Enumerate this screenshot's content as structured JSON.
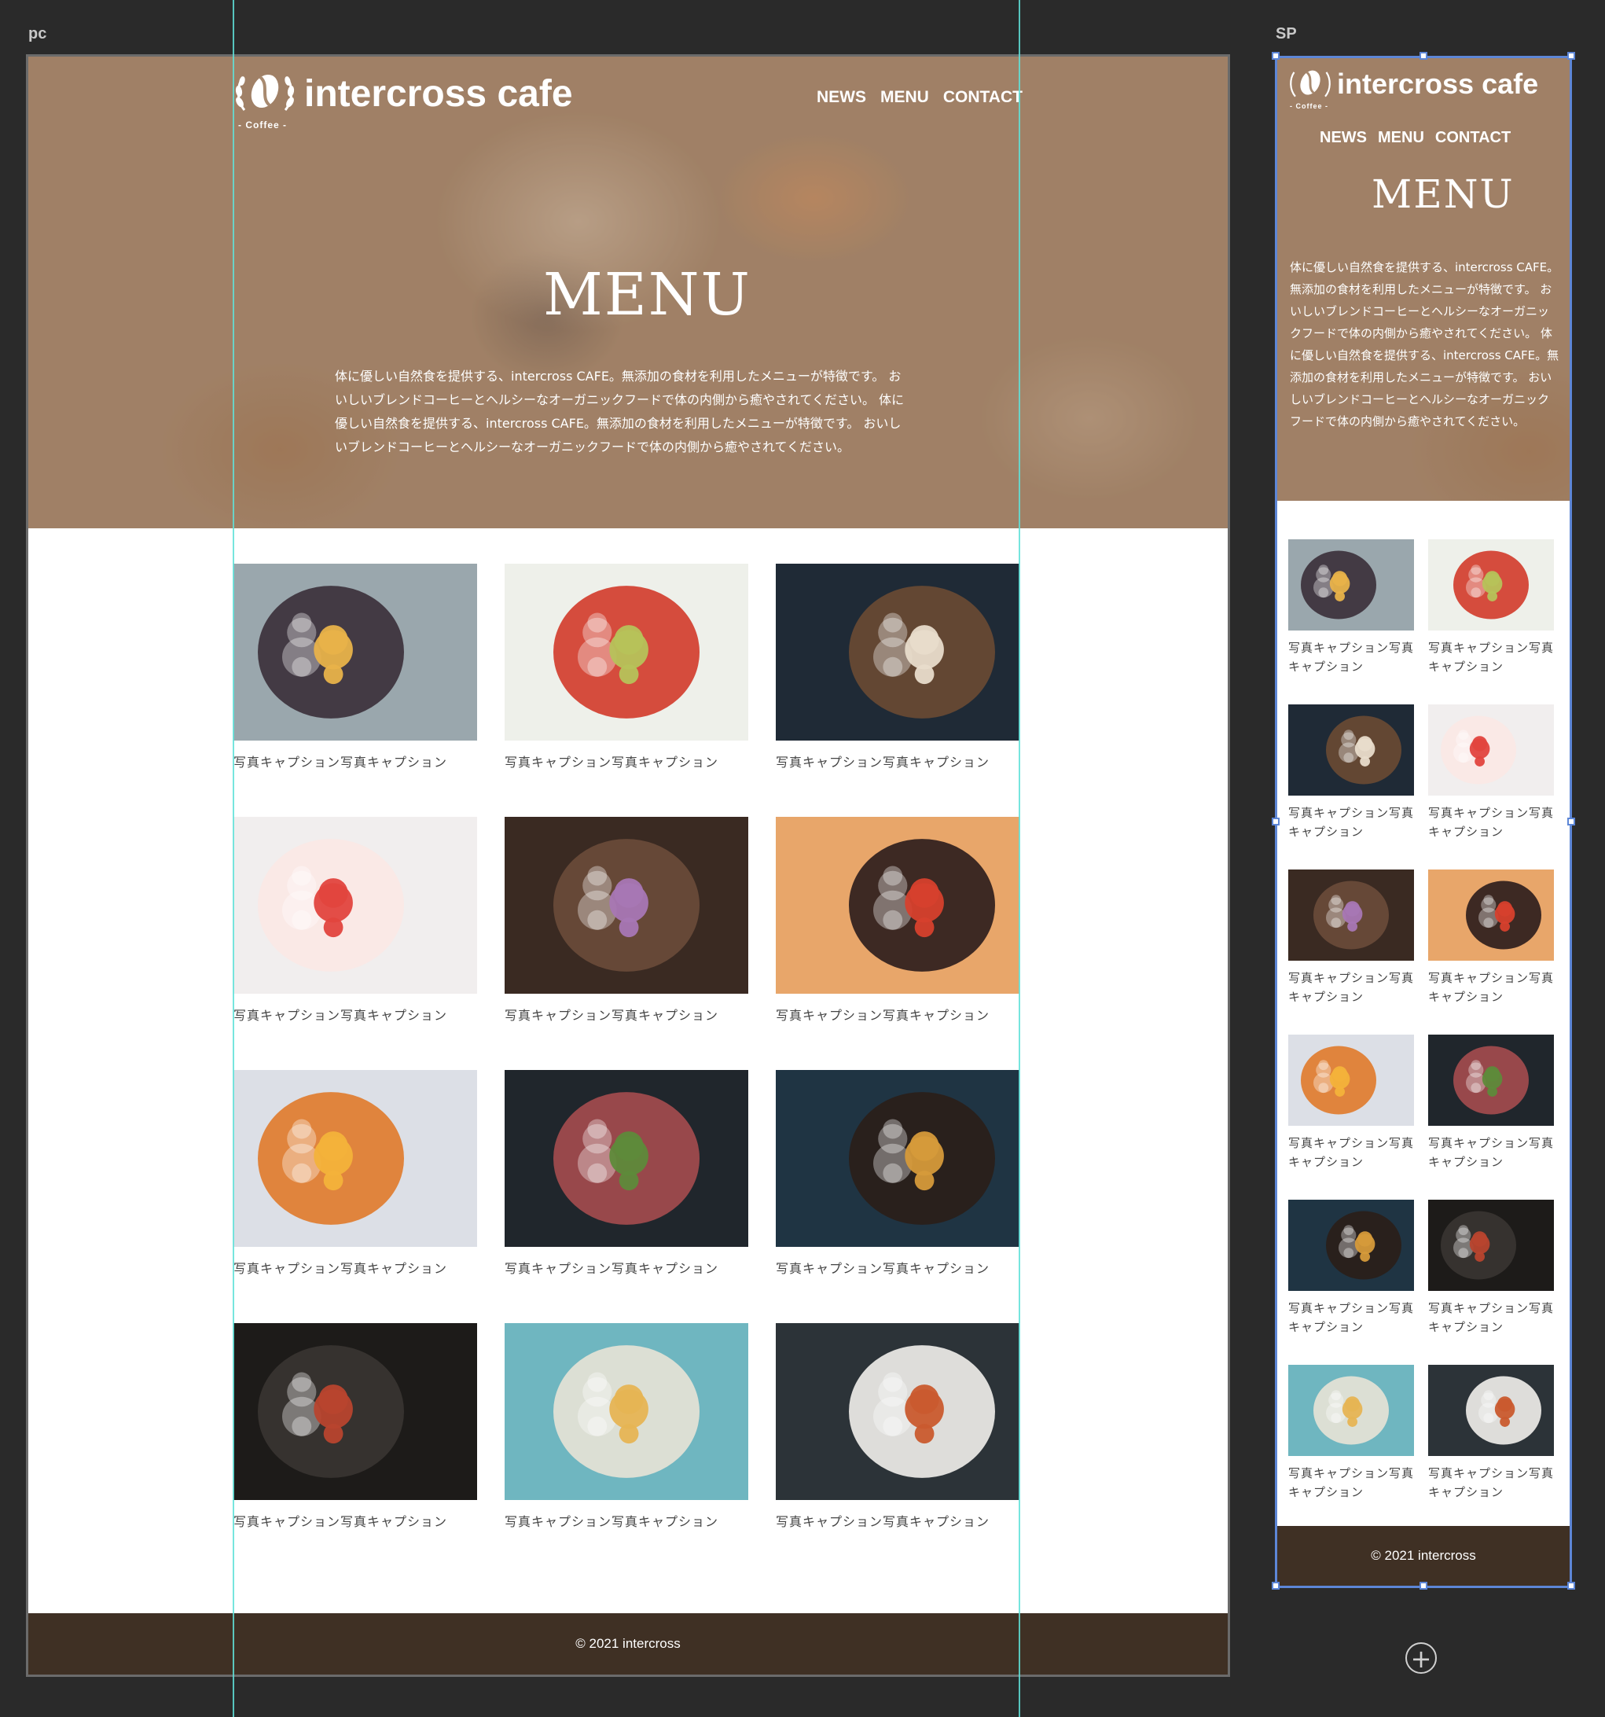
{
  "artboards": {
    "pc_label": "pc",
    "sp_label": "SP"
  },
  "site": {
    "brand": "intercross cafe",
    "brand_sub": "- Coffee -",
    "nav": [
      "NEWS",
      "MENU",
      "CONTACT"
    ],
    "title": "MENU",
    "intro": "体に優しい自然食を提供する、intercross CAFE。無添加の食材を利用したメニューが特徴です。 おいしいブレンドコーヒーとヘルシーなオーガニックフードで体の内側から癒やされてください。 体に優しい自然食を提供する、intercross CAFE。無添加の食材を利用したメニューが特徴です。 おいしいブレンドコーヒーとヘルシーなオーガニックフードで体の内側から癒やされてください。",
    "intro_sp": "体に優しい自然食を提供する、intercross CAFE。無添加の食材を利用したメニューが特徴です。 おいしいブレンドコーヒーとヘルシーなオーガニックフードで体の内側から癒やされてください。 体に優しい自然食を提供する、intercross CAFE。無添加の食材を利用したメニューが特徴です。 おいしいブレンドコーヒーとヘルシーなオーガニックフードで体の内側から癒やされてください。",
    "footer": "© 2021 intercross"
  },
  "menu_items": [
    {
      "caption": "写真キャプション写真キャプション",
      "icon": "fruit-bowl-photo",
      "bg": "#9aa7ad",
      "accent": "#e8b24a",
      "accent2": "#3a2f38"
    },
    {
      "caption": "写真キャプション写真キャプション",
      "icon": "pasta-salad-photo",
      "bg": "#eef0ea",
      "accent": "#b6c25a",
      "accent2": "#d23a2a"
    },
    {
      "caption": "写真キャプション写真キャプション",
      "icon": "dessert-dark-photo",
      "bg": "#1f2a36",
      "accent": "#e8dccb",
      "accent2": "#6a4a33"
    },
    {
      "caption": "写真キャプション写真キャプション",
      "icon": "strawberry-jar-photo",
      "bg": "#f1eeee",
      "accent": "#e2443e",
      "accent2": "#fbe8e4"
    },
    {
      "caption": "写真キャプション写真キャプション",
      "icon": "purple-popsicle-photo",
      "bg": "#3a2a22",
      "accent": "#a877b4",
      "accent2": "#6b4b3a"
    },
    {
      "caption": "写真キャプション写真キャプション",
      "icon": "pepperoni-pizza-photo",
      "bg": "#e8a66a",
      "accent": "#d6402d",
      "accent2": "#2a1c1c"
    },
    {
      "caption": "写真キャプション写真キャプション",
      "icon": "citrus-plate-photo",
      "bg": "#dcdfe6",
      "accent": "#f3b23a",
      "accent2": "#e07a2a"
    },
    {
      "caption": "写真キャプション写真キャプション",
      "icon": "green-salad-photo",
      "bg": "#20262c",
      "accent": "#5e8a3a",
      "accent2": "#a54c4f"
    },
    {
      "caption": "写真キャプション写真キャプション",
      "icon": "pancake-pan-photo",
      "bg": "#1f3443",
      "accent": "#d59a3a",
      "accent2": "#2a1e18"
    },
    {
      "caption": "写真キャプション写真キャプション",
      "icon": "bacon-plate-photo",
      "bg": "#1d1b19",
      "accent": "#b8452e",
      "accent2": "#3a3532"
    },
    {
      "caption": "写真キャプション写真キャプション",
      "icon": "noodle-bowl-photo",
      "bg": "#6fb6c0",
      "accent": "#e6b454",
      "accent2": "#e8e3d6"
    },
    {
      "caption": "写真キャプション写真キャプション",
      "icon": "meatball-plate-photo",
      "bg": "#2c3338",
      "accent": "#c95a2e",
      "accent2": "#f2f0ec"
    }
  ],
  "sp_captions": [
    "写真キャプション写真キャプション",
    "写真キャプション写真キャプション",
    "写真キャプション写真キャプション",
    "写真キャプション写真キャプション",
    "写真キャプション写真キャプション",
    "写真キャプション写真キャプション",
    "写真キャプション写真キャプション",
    "写真キャプション写真キャプション",
    "写真キャプション写真キャプション",
    "写真キャプション写真キャプション",
    "写真キャプション写真キャプション",
    "写真キャプション写真キャプション"
  ],
  "colors": {
    "hero_overlay": "#96765c",
    "footer": "#3f3024",
    "guide": "#5fe0d8",
    "selection": "#5d86d6"
  },
  "add_button": "+"
}
